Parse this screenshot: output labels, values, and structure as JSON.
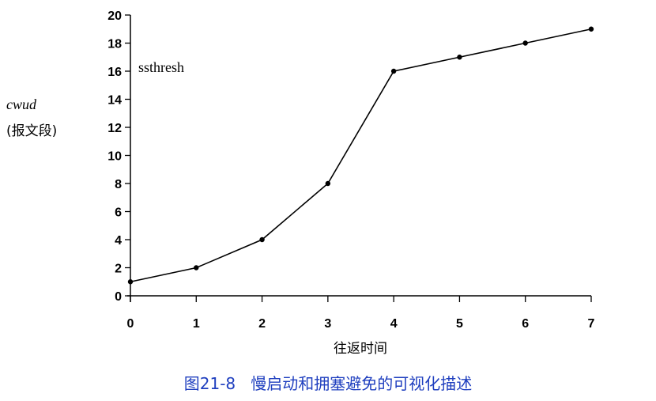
{
  "chart_data": {
    "type": "line",
    "x": [
      0,
      1,
      2,
      3,
      4,
      5,
      6,
      7
    ],
    "series": [
      {
        "values": [
          1,
          2,
          4,
          8,
          16,
          17,
          18,
          19
        ]
      }
    ],
    "xlabel": "往返时间",
    "ylabel": "cwud",
    "ylabel_unit": "(报文段)",
    "x_ticks": [
      "0",
      "1",
      "2",
      "3",
      "4",
      "5",
      "6",
      "7"
    ],
    "y_ticks": [
      "0",
      "2",
      "4",
      "6",
      "8",
      "10",
      "12",
      "14",
      "16",
      "18",
      "20"
    ],
    "xlim": [
      0,
      7
    ],
    "ylim": [
      0,
      20
    ],
    "grid": false,
    "annotations": [
      {
        "text": "ssthresh"
      }
    ],
    "line_color": "#000000"
  },
  "caption": {
    "label": "图21-8",
    "text": "慢启动和拥塞避免的可视化描述",
    "color": "#1f3fbf"
  }
}
